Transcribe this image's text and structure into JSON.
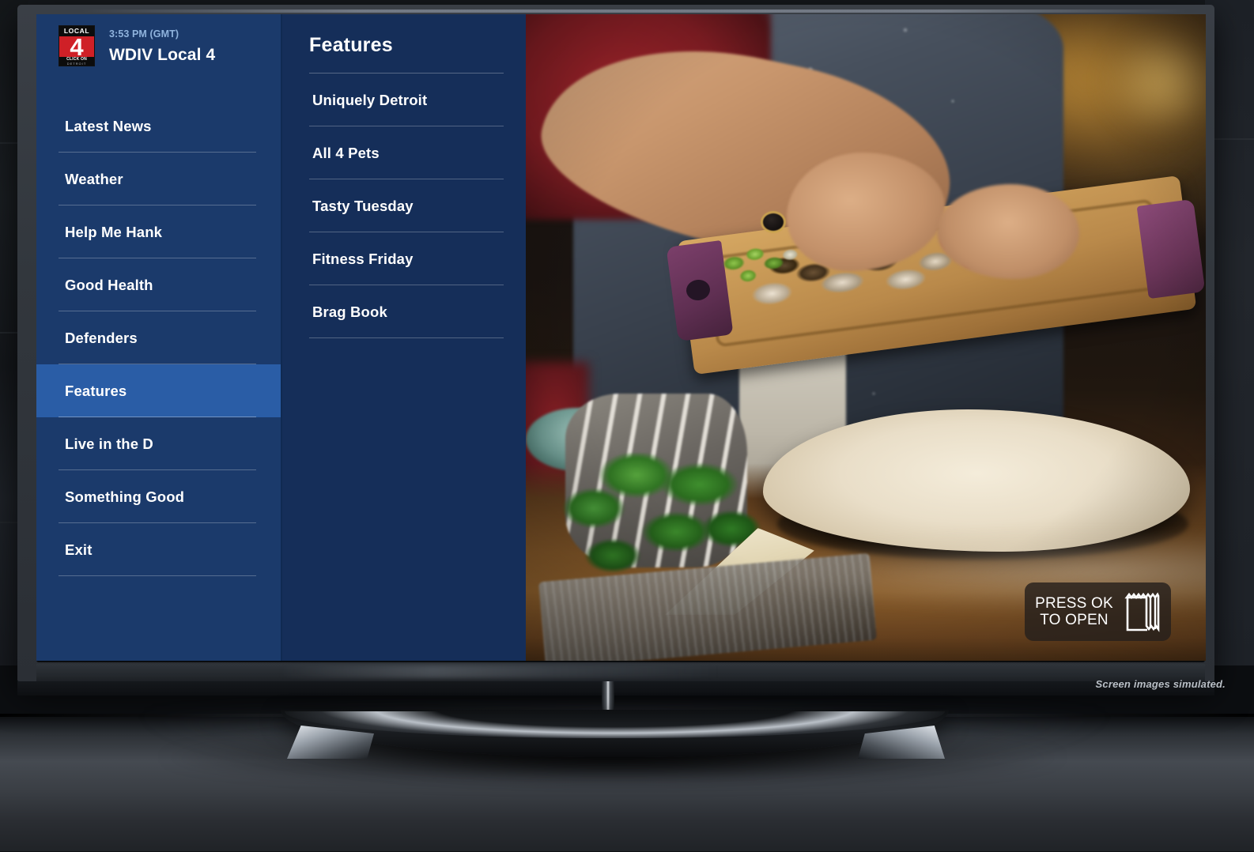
{
  "device": {
    "disclaimer": "Screen images simulated."
  },
  "app": {
    "header": {
      "time": "3:53 PM (GMT)",
      "station": "WDIV Local 4",
      "logo": {
        "top_text": "LOCAL",
        "number": "4",
        "bottom_text_a": "CLICK ON",
        "bottom_text_b": "DETROIT",
        "red": "#cf2027"
      }
    },
    "sidebar": {
      "items": [
        {
          "label": "Latest News",
          "selected": false
        },
        {
          "label": "Weather",
          "selected": false
        },
        {
          "label": "Help Me Hank",
          "selected": false
        },
        {
          "label": "Good Health",
          "selected": false
        },
        {
          "label": "Defenders",
          "selected": false
        },
        {
          "label": "Features",
          "selected": true
        },
        {
          "label": "Live in the D",
          "selected": false
        },
        {
          "label": "Something Good",
          "selected": false
        },
        {
          "label": "Exit",
          "selected": false
        }
      ],
      "selected_bg": "#2a5da6",
      "bg": "#1b3a6b"
    },
    "submenu": {
      "title": "Features",
      "bg": "#152e59",
      "items": [
        {
          "label": "Uniquely Detroit"
        },
        {
          "label": "All 4 Pets"
        },
        {
          "label": "Tasty Tuesday"
        },
        {
          "label": "Fitness Friday"
        },
        {
          "label": "Brag Book"
        }
      ]
    },
    "video": {
      "overlay_badge": {
        "line1": "PRESS OK",
        "line2": "TO OPEN",
        "text": "PRESS OK\nTO OPEN",
        "icon": "receipt-icon"
      }
    }
  }
}
